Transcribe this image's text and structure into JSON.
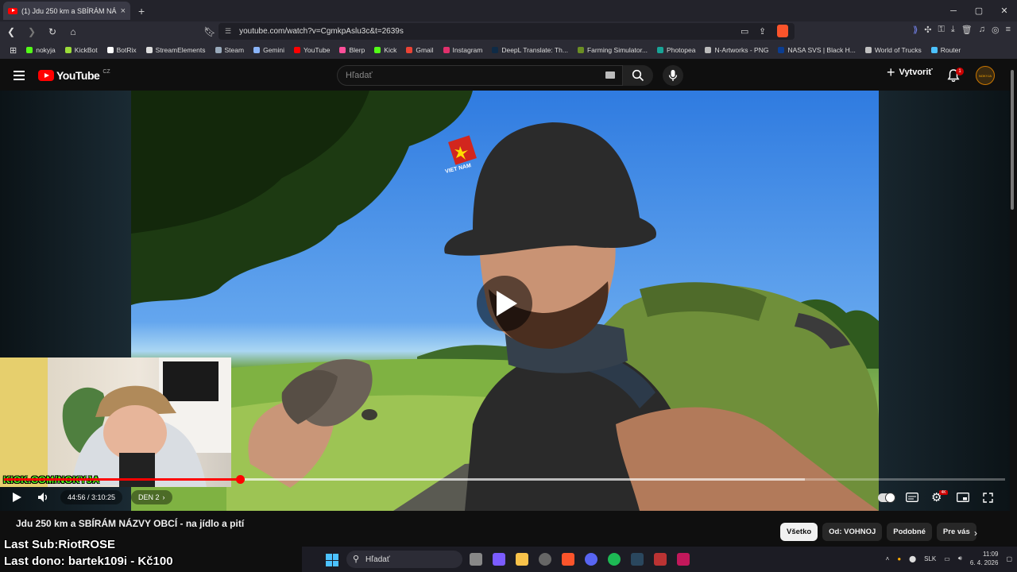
{
  "browser": {
    "tab_title": "(1) Jdu 250 km a SBÍRÁM NÁ...",
    "tab_close": "×",
    "new_tab": "+",
    "url": "youtube.com/watch?v=CgmkpAslu3c&t=2639s",
    "window_controls": [
      "─",
      "▢",
      "✕"
    ],
    "bookmarks": [
      {
        "label": "nokyja",
        "color": "#53fc18"
      },
      {
        "label": "KickBot",
        "color": "#9bdc3a"
      },
      {
        "label": "BotRix",
        "color": "#ffffff"
      },
      {
        "label": "StreamElements",
        "color": "#dddddd"
      },
      {
        "label": "Steam",
        "color": "#9ab"
      },
      {
        "label": "Gemini",
        "color": "#8ab4f8"
      },
      {
        "label": "YouTube",
        "color": "#ff0000"
      },
      {
        "label": "Blerp",
        "color": "#ff4f9a"
      },
      {
        "label": "Kick",
        "color": "#53fc18"
      },
      {
        "label": "Gmail",
        "color": "#ea4335"
      },
      {
        "label": "Instagram",
        "color": "#e1306c"
      },
      {
        "label": "DeepL Translate: Th...",
        "color": "#0f2b46"
      },
      {
        "label": "Farming Simulator...",
        "color": "#6b8e23"
      },
      {
        "label": "Photopea",
        "color": "#18a497"
      },
      {
        "label": "N-Artworks - PNG",
        "color": "#bbbbbb"
      },
      {
        "label": "NASA SVS | Black H...",
        "color": "#0b3d91"
      },
      {
        "label": "World of Trucks",
        "color": "#c0c0c0"
      },
      {
        "label": "Router",
        "color": "#4cc2ff"
      }
    ]
  },
  "youtube": {
    "logo_text": "YouTube",
    "country": "CZ",
    "search_placeholder": "Hľadať",
    "create_label": "Vytvoriť",
    "notification_count": "1",
    "avatar_text": "NOKYJA"
  },
  "player": {
    "time_current": "44:56",
    "time_total": "3:10:25",
    "time_display": "44:56 / 3:10:25",
    "chapter": "DEN 2",
    "progress": 0.236,
    "buffered": 0.8,
    "settings_badge": "4K"
  },
  "webcam": {
    "kick_tag": "KICK.COM/NOKYJA"
  },
  "video": {
    "title": "Jdu 250 km a SBÍRÁM NÁZVY OBCÍ - na jídlo a pití",
    "hat_text": "VIET NAM"
  },
  "chips": [
    {
      "label": "Všetko",
      "active": true
    },
    {
      "label": "Od: VOHNOJ",
      "active": false
    },
    {
      "label": "Podobné",
      "active": false
    },
    {
      "label": "Pre vás",
      "active": false
    }
  ],
  "overlay": {
    "last_sub": "Last Sub:RiotROSE",
    "last_dono": "Last dono: bartek109i - Kč100"
  },
  "taskbar": {
    "search_placeholder": "Hľadať",
    "language": "SLK",
    "time": "11:09",
    "date": "6. 4. 2026"
  }
}
